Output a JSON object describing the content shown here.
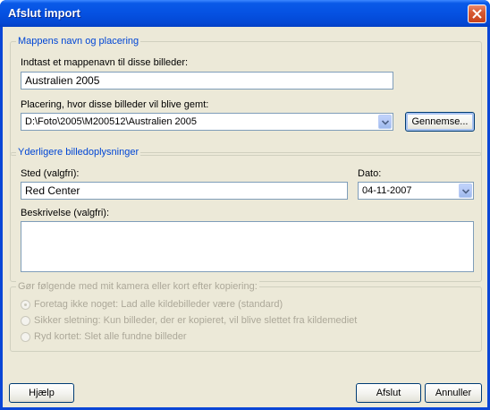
{
  "window": {
    "title": "Afslut import",
    "close_icon": "close-icon"
  },
  "folder_group": {
    "title": "Mappens navn og placering",
    "name_label": "Indtast et mappenavn til disse billeder:",
    "name_value": "Australien 2005",
    "location_label": "Placering, hvor disse billeder vil blive gemt:",
    "location_value": "D:\\Foto\\2005\\M200512\\Australien 2005",
    "browse_label": "Gennemse..."
  },
  "info_group": {
    "title": "Yderligere billedoplysninger",
    "place_label": "Sted (valgfri):",
    "place_value": "Red Center",
    "date_label": "Dato:",
    "date_value": "04-11-2007",
    "description_label": "Beskrivelse (valgfri):",
    "description_value": ""
  },
  "card_group": {
    "title": "Gør følgende med mit kamera eller kort efter kopiering:",
    "options": [
      {
        "label": "Foretag ikke noget: Lad alle kildebilleder være (standard)",
        "checked": true
      },
      {
        "label": "Sikker sletning: Kun billeder, der er kopieret, vil blive slettet fra kildemediet",
        "checked": false
      },
      {
        "label": "Ryd kortet: Slet alle fundne billeder",
        "checked": false
      }
    ]
  },
  "footer": {
    "help_label": "Hjælp",
    "finish_label": "Afslut",
    "cancel_label": "Annuller"
  },
  "colors": {
    "title_bar": "#0551e2",
    "group_title": "#0046d5",
    "dialog_bg": "#ece9d8",
    "disabled_text": "#aca899"
  }
}
